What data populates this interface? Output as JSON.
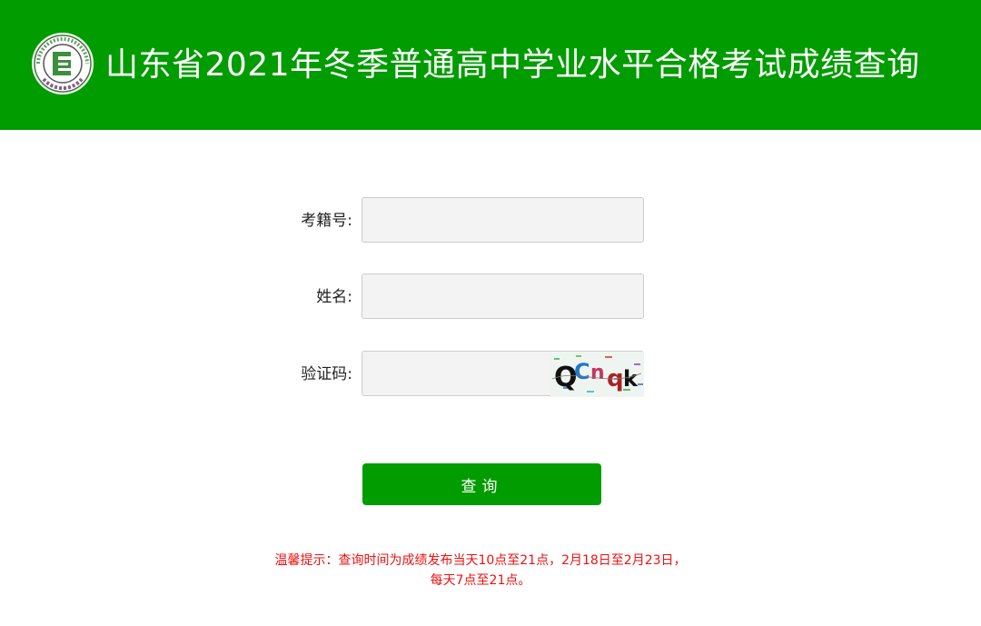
{
  "header": {
    "title": "山东省2021年冬季普通高中学业水平合格考试成绩查询",
    "logo_icon": "exam-seal-logo-icon",
    "logo_ring_text": "Shandong Education Admissions & Examinations",
    "logo_letter": "E",
    "background_color": "#009c00"
  },
  "form": {
    "exam_id": {
      "label": "考籍号:",
      "value": "",
      "placeholder": ""
    },
    "name": {
      "label": "姓名:",
      "value": "",
      "placeholder": ""
    },
    "captcha": {
      "label": "验证码:",
      "value": "",
      "placeholder": "",
      "image_text": "QCnqk"
    }
  },
  "submit": {
    "label": "查询"
  },
  "hint": {
    "line1": "温馨提示：查询时间为成绩发布当天10点至21点，2月18日至2月23日，",
    "line2": "每天7点至21点。",
    "color": "#ee1111"
  }
}
